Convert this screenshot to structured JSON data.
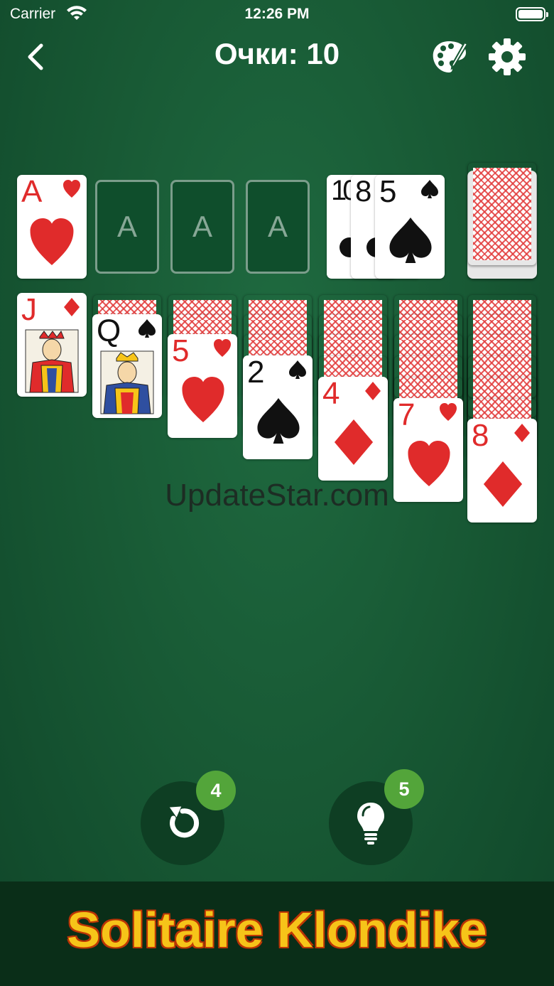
{
  "status_bar": {
    "carrier": "Carrier",
    "time": "12:26 PM"
  },
  "header": {
    "score_label": "Очки: 10"
  },
  "foundations": [
    {
      "rank": "A",
      "suit": "hearts",
      "filled": true
    },
    {
      "placeholder": "A"
    },
    {
      "placeholder": "A"
    },
    {
      "placeholder": "A"
    }
  ],
  "waste": [
    {
      "rank": "10",
      "suit": "clubs"
    },
    {
      "rank": "8",
      "suit": "clubs"
    },
    {
      "rank": "5",
      "suit": "spades"
    }
  ],
  "tableau": [
    {
      "hidden": 0,
      "top": {
        "rank": "J",
        "suit": "diamonds"
      }
    },
    {
      "hidden": 1,
      "top": {
        "rank": "Q",
        "suit": "spades"
      }
    },
    {
      "hidden": 2,
      "top": {
        "rank": "5",
        "suit": "hearts"
      }
    },
    {
      "hidden": 3,
      "top": {
        "rank": "2",
        "suit": "spades"
      }
    },
    {
      "hidden": 4,
      "top": {
        "rank": "4",
        "suit": "diamonds"
      }
    },
    {
      "hidden": 5,
      "top": {
        "rank": "7",
        "suit": "hearts"
      }
    },
    {
      "hidden": 6,
      "top": {
        "rank": "8",
        "suit": "diamonds"
      }
    }
  ],
  "watermark": "UpdateStar.com",
  "controls": {
    "undo_count": "4",
    "hint_count": "5"
  },
  "banner": {
    "title": "Solitaire Klondike"
  },
  "colors": {
    "felt": "#175733",
    "red_suit": "#e02b2b",
    "badge": "#53a53a",
    "banner_text": "#f6c419"
  }
}
